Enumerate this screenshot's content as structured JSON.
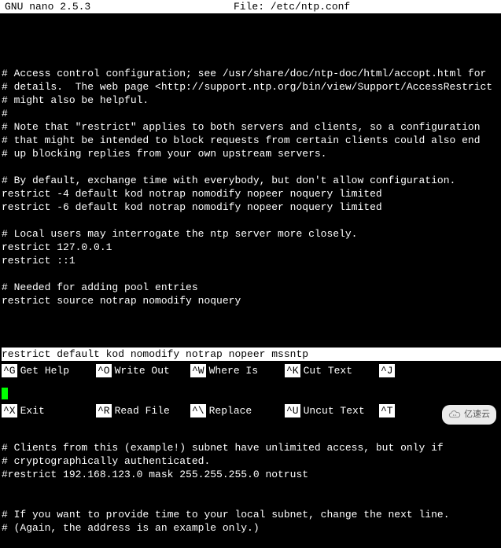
{
  "titlebar": {
    "app": "GNU nano 2.5.3",
    "file_label": "File: /etc/ntp.conf"
  },
  "lines": [
    "",
    "",
    "# Access control configuration; see /usr/share/doc/ntp-doc/html/accopt.html for",
    "# details.  The web page <http://support.ntp.org/bin/view/Support/AccessRestrict",
    "# might also be helpful.",
    "#",
    "# Note that \"restrict\" applies to both servers and clients, so a configuration",
    "# that might be intended to block requests from certain clients could also end",
    "# up blocking replies from your own upstream servers.",
    "",
    "# By default, exchange time with everybody, but don't allow configuration.",
    "restrict -4 default kod notrap nomodify nopeer noquery limited",
    "restrict -6 default kod notrap nomodify nopeer noquery limited",
    "",
    "# Local users may interrogate the ntp server more closely.",
    "restrict 127.0.0.1",
    "restrict ::1",
    "",
    "# Needed for adding pool entries",
    "restrict source notrap nomodify noquery",
    ""
  ],
  "highlighted_line": "restrict default kod nomodify notrap nopeer mssntp",
  "lines_after": [
    "",
    "# Clients from this (example!) subnet have unlimited access, but only if",
    "# cryptographically authenticated.",
    "#restrict 192.168.123.0 mask 255.255.255.0 notrust",
    "",
    "",
    "# If you want to provide time to your local subnet, change the next line.",
    "# (Again, the address is an example only.)"
  ],
  "shortcuts": {
    "row1": [
      {
        "key": "^G",
        "label": "Get Help"
      },
      {
        "key": "^O",
        "label": "Write Out"
      },
      {
        "key": "^W",
        "label": "Where Is"
      },
      {
        "key": "^K",
        "label": "Cut Text"
      },
      {
        "key": "^J",
        "label": ""
      }
    ],
    "row2": [
      {
        "key": "^X",
        "label": "Exit"
      },
      {
        "key": "^R",
        "label": "Read File"
      },
      {
        "key": "^\\",
        "label": "Replace"
      },
      {
        "key": "^U",
        "label": "Uncut Text"
      },
      {
        "key": "^T",
        "label": ""
      }
    ]
  },
  "watermark": "亿速云"
}
